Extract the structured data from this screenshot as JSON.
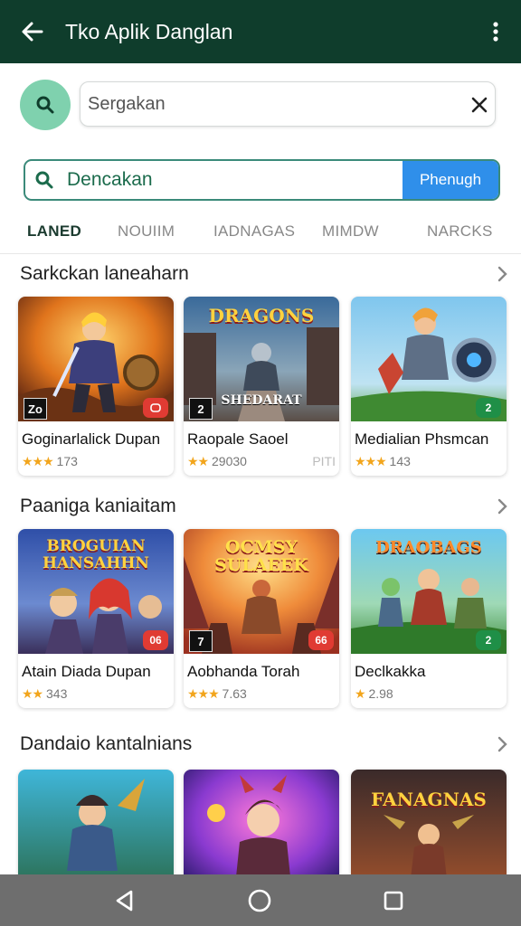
{
  "appbar": {
    "title": "Tko Aplik Danglan",
    "back_icon": "arrow-left-icon",
    "menu_icon": "more-vert-icon"
  },
  "search": {
    "placeholder": "Sergakan",
    "value": ""
  },
  "searchbar2": {
    "label": "Dencakan",
    "button": "Phenugh"
  },
  "tabs": [
    {
      "label": "LANED",
      "active": true
    },
    {
      "label": "NOUIIM",
      "active": false
    },
    {
      "label": "IADNAGAS",
      "active": false
    },
    {
      "label": "MIMDW",
      "active": false
    },
    {
      "label": "NARCKS",
      "active": false
    }
  ],
  "sections": [
    {
      "title": "Sarkckan laneaharn",
      "cards": [
        {
          "name": "Goginarlalick Dupan",
          "stars": "★★★",
          "rating": "173",
          "badge": "",
          "rbadge": "Zo",
          "cap": ""
        },
        {
          "name": "Raopale Saoel",
          "stars": "★★",
          "rating": "29030",
          "extra": "PITI",
          "badge": "",
          "rbadge": "2",
          "cap": "DRAGONS",
          "caplow": "SHEDARAT"
        },
        {
          "name": "Medialian Phsmcan",
          "stars": "★★★",
          "rating": "143",
          "badge": "2",
          "rbadge": "",
          "cap": ""
        }
      ]
    },
    {
      "title": "Paaniga kaniaitam",
      "cards": [
        {
          "name": "Atain Diada Dupan",
          "stars": "★★",
          "rating": "343",
          "badge": "06",
          "rbadge": "",
          "cap": "BROGUIAN HANSAHHN"
        },
        {
          "name": "Aobhanda Torah",
          "stars": "★★★",
          "rating": "7.63",
          "badge": "66",
          "rbadge": "7",
          "cap": "OCMSY SULAEEK"
        },
        {
          "name": "Declkakka",
          "stars": "★",
          "rating": "2.98",
          "badge": "2",
          "rbadge": "",
          "cap": "DRAOBAGS"
        }
      ]
    },
    {
      "title": "Dandaio kantalnians",
      "cards": [
        {
          "name": "",
          "stars": "",
          "rating": "",
          "badge": "",
          "rbadge": "",
          "cap": ""
        },
        {
          "name": "",
          "stars": "",
          "rating": "",
          "badge": "",
          "rbadge": "",
          "cap": ""
        },
        {
          "name": "",
          "stars": "",
          "rating": "",
          "badge": "",
          "rbadge": "",
          "cap": "FANAGNAS"
        }
      ]
    }
  ],
  "colors": {
    "appbar": "#0f3d2c",
    "accent": "#2f8fea",
    "green": "#1b6b4c",
    "star": "#f2a51c"
  }
}
